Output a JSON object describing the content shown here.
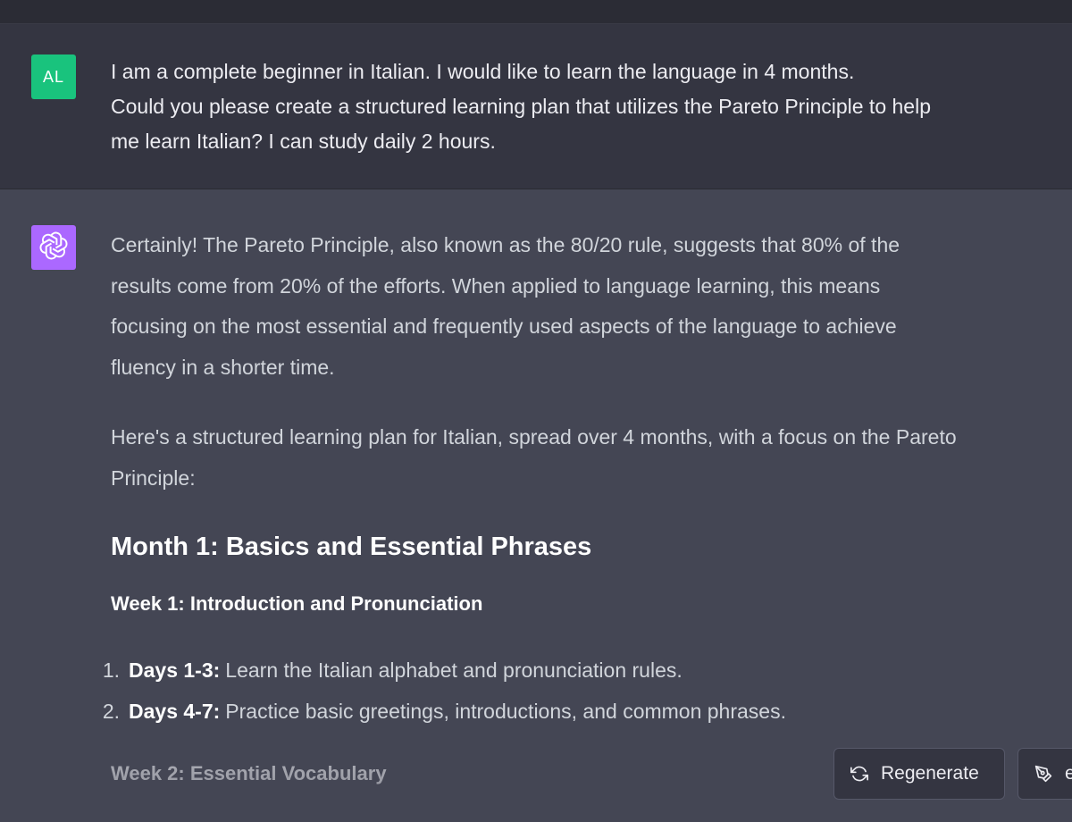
{
  "user_message": {
    "avatar_initials": "AL",
    "lines": [
      "I am a complete beginner in Italian. I would like to learn the language in 4 months.",
      "Could you please create a structured learning plan that utilizes the Pareto Principle to help",
      "me learn Italian? I can study daily 2 hours."
    ]
  },
  "assistant_message": {
    "avatar_icon": "openai-logo-icon",
    "intro_lines": [
      "Certainly! The Pareto Principle, also known as the 80/20 rule, suggests that 80% of the",
      "results come from 20% of the efforts. When applied to language learning, this means",
      "focusing on the most essential and frequently used aspects of the language to achieve",
      "fluency in a shorter time."
    ],
    "plan_lines": [
      "Here's a structured learning plan for Italian, spread over 4 months, with a focus on the Pareto",
      "Principle:"
    ],
    "month_heading": "Month 1: Basics and Essential Phrases",
    "week1_heading": "Week 1: Introduction and Pronunciation",
    "week1_items": [
      {
        "num": "1.",
        "label": "Days 1-3:",
        "text": "Learn the Italian alphabet and pronunciation rules."
      },
      {
        "num": "2.",
        "label": "Days 4-7:",
        "text": "Practice basic greetings, introductions, and common phrases."
      }
    ],
    "week2_heading": "Week 2: Essential Vocabulary"
  },
  "actions": {
    "regenerate_label": "Regenerate",
    "edit_label_partial": "e"
  },
  "colors": {
    "user_bg": "#343541",
    "assistant_bg": "#444654",
    "user_avatar": "#19c37d",
    "bot_avatar": "#ab68ff"
  }
}
